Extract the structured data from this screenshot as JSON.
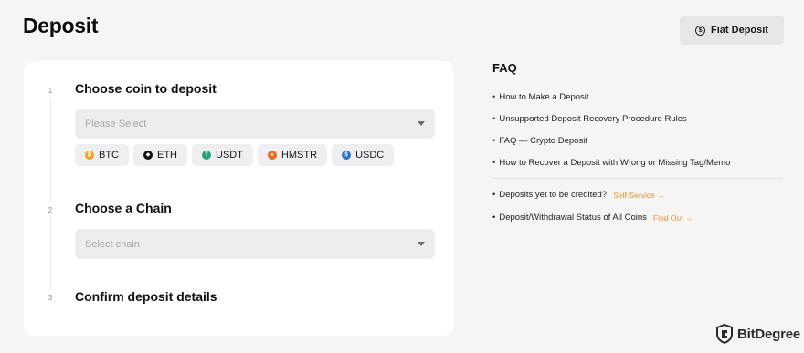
{
  "header": {
    "title": "Deposit",
    "fiat_button": "Fiat Deposit"
  },
  "steps": [
    {
      "number": "1",
      "title": "Choose coin to deposit"
    },
    {
      "number": "2",
      "title": "Choose a Chain"
    },
    {
      "number": "3",
      "title": "Confirm deposit details"
    }
  ],
  "coin_select": {
    "placeholder": "Please Select"
  },
  "chain_select": {
    "placeholder": "Select chain"
  },
  "coins": [
    {
      "label": "BTC",
      "icon": "btc-icon",
      "color": "#f7a21b"
    },
    {
      "label": "ETH",
      "icon": "eth-icon",
      "color": "#111111"
    },
    {
      "label": "USDT",
      "icon": "usdt-icon",
      "color": "#26a17b"
    },
    {
      "label": "HMSTR",
      "icon": "hmstr-icon",
      "color": "#e96b1f"
    },
    {
      "label": "USDC",
      "icon": "usdc-icon",
      "color": "#2f74c8"
    }
  ],
  "faq": {
    "title": "FAQ",
    "items": [
      "How to Make a Deposit",
      "Unsupported Deposit Recovery Procedure Rules",
      "FAQ — Crypto Deposit",
      "How to Recover a Deposit with Wrong or Missing Tag/Memo"
    ],
    "extra": [
      {
        "text": "Deposits yet to be credited?",
        "link": "Self-Service →"
      },
      {
        "text": "Deposit/Withdrawal Status of All Coins",
        "link": "Find Out →"
      }
    ]
  },
  "watermark": {
    "text": "BitDegree"
  },
  "colors": {
    "accent": "#e8922a",
    "background": "#f5f5f6",
    "card": "#ffffff"
  }
}
